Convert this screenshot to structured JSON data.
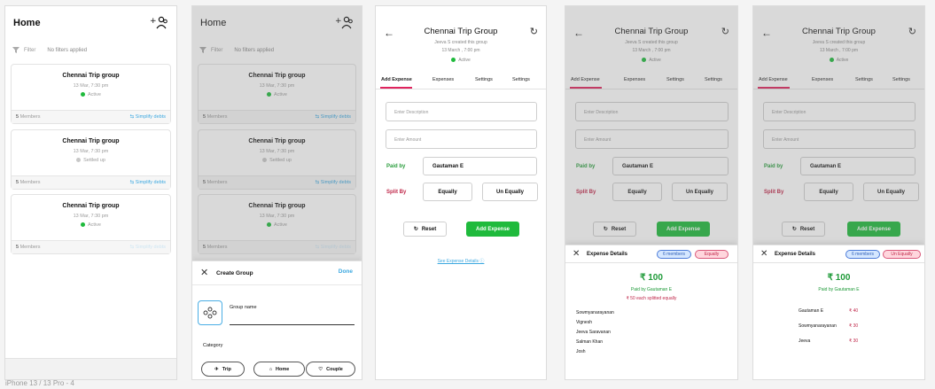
{
  "frame_label": "iPhone 13 / 13 Pro - 4",
  "home": {
    "title": "Home",
    "filter_label": "Filter",
    "filter_text": "No filters applied",
    "groups": [
      {
        "name": "Chennai  Trip group",
        "date": "13 Mar,  7:30 pm",
        "status": "Active",
        "members": "5",
        "members_label": "Members",
        "simplify": "Simplify debts"
      },
      {
        "name": "Chennai  Trip group",
        "date": "13 Mar,  7:30 pm",
        "status": "Settled up",
        "members": "5",
        "members_label": "Members",
        "simplify": "Simplify debts"
      },
      {
        "name": "Chennai  Trip group",
        "date": "13 Mar,  7:30 pm",
        "status": "Active",
        "members": "5",
        "members_label": "Members",
        "simplify": "Simplify debts"
      }
    ]
  },
  "create_group": {
    "title": "Create Group",
    "done": "Done",
    "group_name_label": "Group name",
    "category_label": "Category",
    "categories": [
      "Trip",
      "Home",
      "Couple"
    ]
  },
  "group": {
    "title": "Chennai Trip Group",
    "created_by": "Jeeva S created this group",
    "created_date": "13 March , 7:00 pm",
    "status": "Active",
    "tabs": [
      "Add Expense",
      "Expenses",
      "Settings",
      "Settings"
    ],
    "description_placeholder": "Enter Description",
    "amount_placeholder": "Enter Amount",
    "paid_by_label": "Paid by",
    "paid_by_value": "Gautaman E",
    "split_by_label": "Split By",
    "split_equally": "Equally",
    "split_unequally": "Un Equally",
    "reset": "Reset",
    "add_expense": "Add Expense",
    "see_details": "See Expense Details"
  },
  "expense_details": {
    "title": "Expense Details",
    "members_badge": "6 members",
    "equally_badge": "Equally",
    "unequally_badge": "Un Equally",
    "amount": "₹ 100",
    "paid_by": "Paid by Gautaman E",
    "each_split": "₹ 50 each splitted equally",
    "members": [
      "Sowmyanarayanan",
      "Vignesh",
      "Jeeva  Saravanan",
      "Salman Khan",
      "Josh"
    ],
    "shares": [
      {
        "name": "Gautaman E",
        "amount": "₹ 40"
      },
      {
        "name": "Sowmyanarayanan",
        "amount": "₹ 30"
      },
      {
        "name": "Jeeva",
        "amount": "₹ 30"
      }
    ]
  },
  "colors": {
    "accent_blue": "#3ca8e0",
    "active_green": "#1fba3c",
    "tab_pink": "#e0245e",
    "split_red": "#c0284a"
  }
}
